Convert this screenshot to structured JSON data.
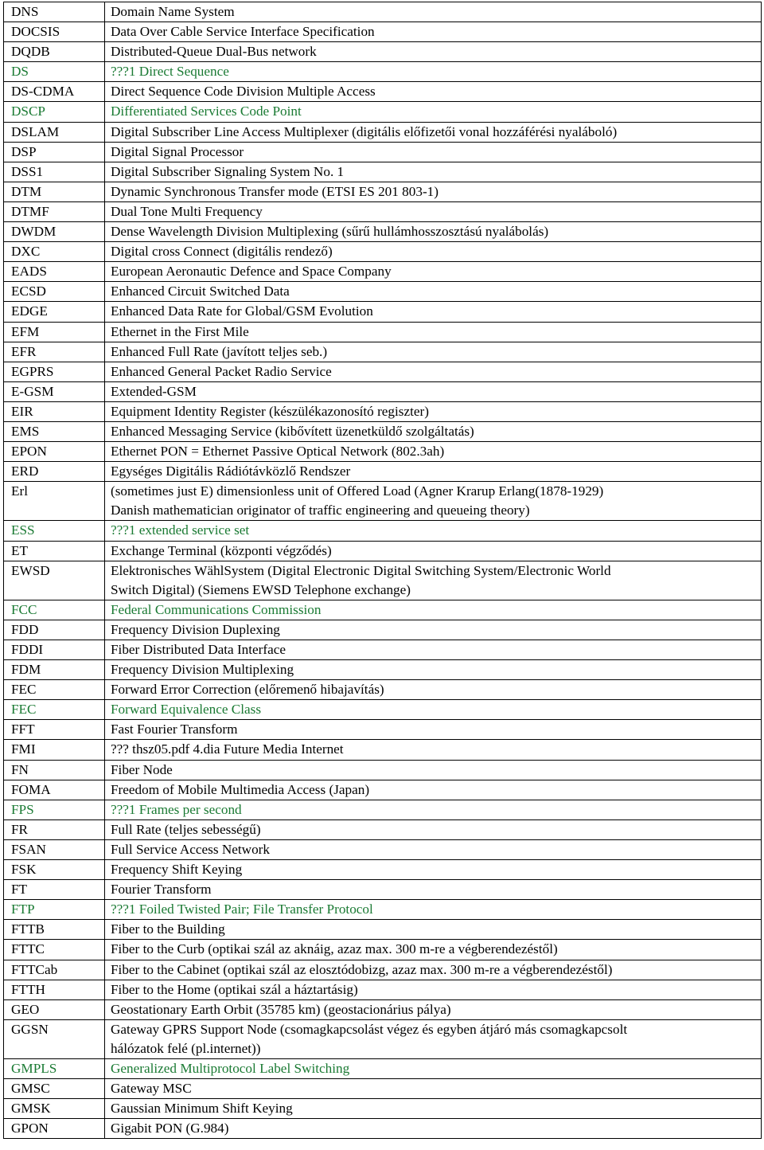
{
  "document": {
    "kind": "abbreviation-glossary-table",
    "columns": [
      "Abbreviation",
      "Meaning"
    ],
    "accent_green": "#1a7a33",
    "text_color": "#000000"
  },
  "rows": [
    {
      "abbr": "DNS",
      "def": "Domain Name System",
      "green": false,
      "lines": 1
    },
    {
      "abbr": "DOCSIS",
      "def": "Data Over Cable Service Interface Specification",
      "green": false,
      "lines": 1
    },
    {
      "abbr": "DQDB",
      "def": "Distributed-Queue Dual-Bus network",
      "green": false,
      "lines": 1
    },
    {
      "abbr": "DS",
      "def": "???1 Direct Sequence",
      "green": true,
      "lines": 1
    },
    {
      "abbr": "DS-CDMA",
      "def": "Direct Sequence Code Division Multiple Access",
      "green": false,
      "lines": 1
    },
    {
      "abbr": "DSCP",
      "def": "Differentiated Services Code Point",
      "green": true,
      "lines": 1
    },
    {
      "abbr": "DSLAM",
      "def": "Digital Subscriber Line Access Multiplexer (digitális előfizetői vonal hozzáférési nyaláboló)",
      "green": false,
      "lines": 1
    },
    {
      "abbr": "DSP",
      "def": "Digital Signal Processor",
      "green": false,
      "lines": 1
    },
    {
      "abbr": "DSS1",
      "def": "Digital Subscriber Signaling System No. 1",
      "green": false,
      "lines": 1
    },
    {
      "abbr": "DTM",
      "def": "Dynamic Synchronous Transfer mode (ETSI ES 201 803-1)",
      "green": false,
      "lines": 1
    },
    {
      "abbr": "DTMF",
      "def": "Dual Tone Multi Frequency",
      "green": false,
      "lines": 1
    },
    {
      "abbr": "DWDM",
      "def": "Dense Wavelength Division Multiplexing (sűrű hullámhosszosztású nyalábolás)",
      "green": false,
      "lines": 1
    },
    {
      "abbr": "DXC",
      "def": "Digital cross Connect (digitális rendező)",
      "green": false,
      "lines": 1
    },
    {
      "abbr": "EADS",
      "def": "European Aeronautic Defence and Space Company",
      "green": false,
      "lines": 1
    },
    {
      "abbr": "ECSD",
      "def": "Enhanced Circuit Switched Data",
      "green": false,
      "lines": 1
    },
    {
      "abbr": "EDGE",
      "def": "Enhanced Data Rate for Global/GSM Evolution",
      "green": false,
      "lines": 1
    },
    {
      "abbr": "EFM",
      "def": "Ethernet in the First Mile",
      "green": false,
      "lines": 1
    },
    {
      "abbr": "EFR",
      "def": "Enhanced Full Rate (javított teljes seb.)",
      "green": false,
      "lines": 1
    },
    {
      "abbr": "EGPRS",
      "def": "Enhanced General Packet Radio Service",
      "green": false,
      "lines": 1
    },
    {
      "abbr": "E-GSM",
      "def": "Extended-GSM",
      "green": false,
      "lines": 1
    },
    {
      "abbr": "EIR",
      "def": "Equipment Identity Register (készülékazonosító regiszter)",
      "green": false,
      "lines": 1
    },
    {
      "abbr": "EMS",
      "def": "Enhanced Messaging Service (kibővített üzenetküldő szolgáltatás)",
      "green": false,
      "lines": 1
    },
    {
      "abbr": "EPON",
      "def": "Ethernet PON = Ethernet Passive Optical Network (802.3ah)",
      "green": false,
      "lines": 1
    },
    {
      "abbr": "ERD",
      "def": "Egységes Digitális Rádiótávközlő Rendszer",
      "green": false,
      "lines": 1
    },
    {
      "abbr": "Erl",
      "def": "(sometimes just E) dimensionless unit of Offered Load (Agner Krarup Erlang(1878-1929)\nDanish mathematician originator of traffic engineering and queueing theory)",
      "green": false,
      "lines": 2
    },
    {
      "abbr": "ESS",
      "def": "???1 extended service set",
      "green": true,
      "lines": 1
    },
    {
      "abbr": "ET",
      "def": "Exchange Terminal (központi végződés)",
      "green": false,
      "lines": 1
    },
    {
      "abbr": "EWSD",
      "def": "Elektronisches WählSystem (Digital Electronic Digital Switching System/Electronic World\nSwitch Digital) (Siemens EWSD Telephone exchange)",
      "green": false,
      "lines": 2
    },
    {
      "abbr": "FCC",
      "def": "Federal Communications Commission",
      "green": true,
      "lines": 1
    },
    {
      "abbr": "FDD",
      "def": "Frequency Division Duplexing",
      "green": false,
      "lines": 1
    },
    {
      "abbr": "FDDI",
      "def": "Fiber Distributed Data Interface",
      "green": false,
      "lines": 1
    },
    {
      "abbr": "FDM",
      "def": "Frequency Division Multiplexing",
      "green": false,
      "lines": 1
    },
    {
      "abbr": "FEC",
      "def": "Forward Error Correction (előremenő hibajavítás)",
      "green": false,
      "lines": 1
    },
    {
      "abbr": "FEC",
      "def": "Forward Equivalence Class",
      "green": true,
      "lines": 1
    },
    {
      "abbr": "FFT",
      "def": "Fast Fourier Transform",
      "green": false,
      "lines": 1
    },
    {
      "abbr": "FMI",
      "def": "??? thsz05.pdf 4.dia Future Media Internet",
      "green": false,
      "lines": 1
    },
    {
      "abbr": "FN",
      "def": "Fiber Node",
      "green": false,
      "lines": 1
    },
    {
      "abbr": "FOMA",
      "def": "Freedom of Mobile Multimedia Access (Japan)",
      "green": false,
      "lines": 1
    },
    {
      "abbr": "FPS",
      "def": "???1 Frames per second",
      "green": true,
      "lines": 1
    },
    {
      "abbr": "FR",
      "def": "Full Rate (teljes sebességű)",
      "green": false,
      "lines": 1
    },
    {
      "abbr": "FSAN",
      "def": "Full Service Access Network",
      "green": false,
      "lines": 1
    },
    {
      "abbr": "FSK",
      "def": "Frequency Shift Keying",
      "green": false,
      "lines": 1
    },
    {
      "abbr": "FT",
      "def": "Fourier Transform",
      "green": false,
      "lines": 1
    },
    {
      "abbr": "FTP",
      "def": "???1 Foiled Twisted Pair; File Transfer Protocol",
      "green": true,
      "lines": 1
    },
    {
      "abbr": "FTTB",
      "def": "Fiber to the Building",
      "green": false,
      "lines": 1
    },
    {
      "abbr": "FTTC",
      "def": "Fiber to the Curb (optikai szál az aknáig, azaz max. 300 m-re a végberendezéstől)",
      "green": false,
      "lines": 1
    },
    {
      "abbr": "FTTCab",
      "def": "Fiber to the Cabinet (optikai szál az elosztódobizg, azaz max. 300 m-re a végberendezéstől)",
      "green": false,
      "lines": 1
    },
    {
      "abbr": "FTTH",
      "def": "Fiber to the Home (optikai szál a háztartásig)",
      "green": false,
      "lines": 1
    },
    {
      "abbr": "GEO",
      "def": "Geostationary Earth Orbit (35785 km) (geostacionárius pálya)",
      "green": false,
      "lines": 1
    },
    {
      "abbr": "GGSN",
      "def": "Gateway GPRS Support Node (csomagkapcsolást végez és egyben átjáró más csomagkapcsolt\nhálózatok felé (pl.internet))",
      "green": false,
      "lines": 2
    },
    {
      "abbr": "GMPLS",
      "def": "Generalized Multiprotocol Label Switching",
      "green": true,
      "lines": 1
    },
    {
      "abbr": "GMSC",
      "def": "Gateway MSC",
      "green": false,
      "lines": 1
    },
    {
      "abbr": "GMSK",
      "def": "Gaussian Minimum Shift Keying",
      "green": false,
      "lines": 1
    },
    {
      "abbr": "GPON",
      "def": "Gigabit PON (G.984)",
      "green": false,
      "lines": 1
    }
  ]
}
